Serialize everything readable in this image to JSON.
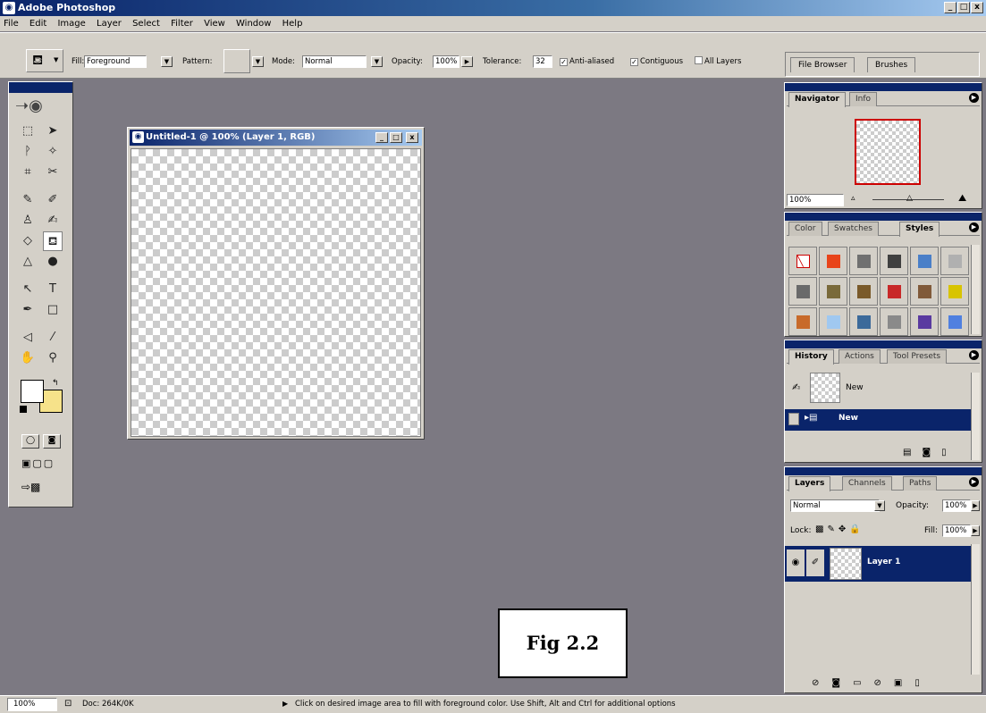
{
  "app": {
    "title": "Adobe Photoshop",
    "logo_icon": "photoshop-eye-icon",
    "minimize": "_",
    "maximize": "□",
    "close": "x"
  },
  "menu": [
    "File",
    "Edit",
    "Image",
    "Layer",
    "Select",
    "Filter",
    "View",
    "Window",
    "Help"
  ],
  "options": {
    "fill_label": "Fill:",
    "fill_value": "Foreground",
    "pattern_label": "Pattern:",
    "mode_label": "Mode:",
    "mode_value": "Normal",
    "opacity_label": "Opacity:",
    "opacity_value": "100%",
    "tolerance_label": "Tolerance:",
    "tolerance_value": "32",
    "anti_aliased": "Anti-aliased",
    "anti_aliased_checked": true,
    "contiguous": "Contiguous",
    "contiguous_checked": true,
    "all_layers": "All Layers",
    "all_layers_checked": false
  },
  "palette_well": {
    "tabs": [
      "File Browser",
      "Brushes"
    ]
  },
  "toolbox": {
    "tools": [
      "marquee-icon",
      "move-icon",
      "lasso-icon",
      "magic-wand-icon",
      "crop-icon",
      "slice-icon",
      "healing-brush-icon",
      "brush-icon",
      "clone-stamp-icon",
      "history-brush-icon",
      "eraser-icon",
      "paint-bucket-icon",
      "blur-icon",
      "dodge-icon",
      "path-selection-icon",
      "type-icon",
      "pen-icon",
      "rectangle-icon",
      "notes-icon",
      "eyedropper-icon",
      "hand-icon",
      "zoom-icon"
    ],
    "foreground": "#ffffff",
    "background": "#f6e28a"
  },
  "document": {
    "title": "Untitled-1 @ 100% (Layer 1, RGB)"
  },
  "navigator": {
    "tabs": [
      "Navigator",
      "Info"
    ],
    "zoom": "100%"
  },
  "styles": {
    "tabs": [
      "Color",
      "Swatches",
      "Styles"
    ],
    "swatch_colors": [
      "#ffffff",
      "#e8441a",
      "#707070",
      "#404040",
      "#4a7fc8",
      "#b0b0b0",
      "#6a6a6a",
      "#7a6a3a",
      "#7a5a2a",
      "#c82828",
      "#805a3a",
      "#d8c400",
      "#c86a2a",
      "#a0c8f0",
      "#3c6a9a",
      "#8a8a8a",
      "#5a3aa0",
      "#5080e0"
    ]
  },
  "history": {
    "tabs": [
      "History",
      "Actions",
      "Tool Presets"
    ],
    "snapshot_label": "New",
    "item_label": "New"
  },
  "layers": {
    "tabs": [
      "Layers",
      "Channels",
      "Paths"
    ],
    "blend_mode": "Normal",
    "opacity_label": "Opacity:",
    "opacity_value": "100%",
    "lock_label": "Lock:",
    "fill_label": "Fill:",
    "fill_value": "100%",
    "layer_name": "Layer 1"
  },
  "figure_label": "Fig 2.2",
  "status": {
    "zoom": "100%",
    "doc": "Doc: 264K/0K",
    "hint": "Click on desired image area to fill with foreground color.  Use Shift, Alt and Ctrl for additional options"
  }
}
